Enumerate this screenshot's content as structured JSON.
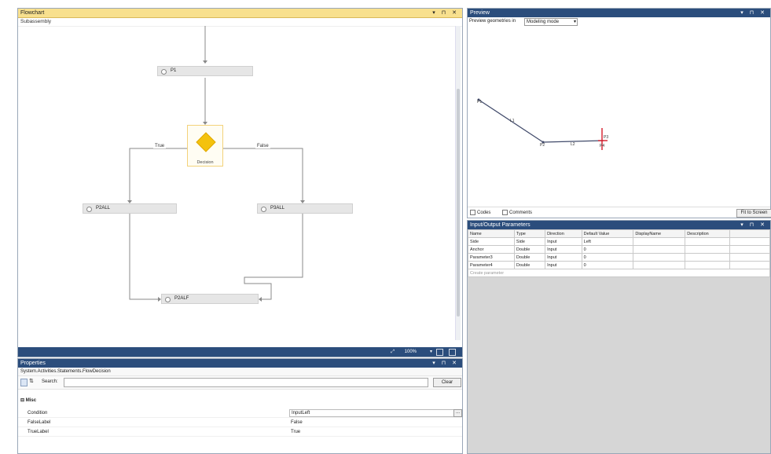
{
  "flowchart": {
    "title": "Flowchart",
    "title_buttons": "▾ ⊓ ✕",
    "breadcrumb": "Subassembly",
    "nodes": {
      "top": "P1",
      "left": "P2ALL",
      "right": "P3ALL",
      "bottom": "P2ALF",
      "decision": "Decision"
    },
    "edges": {
      "true_label": "True",
      "false_label": "False"
    },
    "status": {
      "zoom": "100%"
    }
  },
  "properties": {
    "title": "Properties",
    "title_buttons": "▾ ⊓ ✕",
    "type_path": "System.Activities.Statements.FlowDecision",
    "search_label": "Search:",
    "search_value": "",
    "clear_button": "Clear",
    "section": "Misc",
    "rows": [
      {
        "name": "Condition",
        "value": "InputLeft"
      },
      {
        "name": "FalseLabel",
        "value": "False"
      },
      {
        "name": "TrueLabel",
        "value": "True"
      }
    ],
    "ellipsis": "..."
  },
  "preview": {
    "title": "Preview",
    "title_buttons": "▾ ⊓ ✕",
    "geometry_label": "Preview geometries in",
    "geometry_select": "Modeling mode",
    "codes_label": "Codes",
    "comments_label": "Comments",
    "fit_button": "Fit to Screen",
    "points": [
      "P1",
      "P2",
      "P3",
      "P4"
    ],
    "segments": [
      "L1",
      "L2"
    ]
  },
  "ioparams": {
    "title": "Input/Output Parameters",
    "title_buttons": "▾ ⊓ ✕",
    "columns": [
      "Name",
      "Type",
      "Direction",
      "Default Value",
      "DisplayName",
      "Description"
    ],
    "rows": [
      [
        "Side",
        "Side",
        "Input",
        "Left",
        "",
        ""
      ],
      [
        "Anchor",
        "Double",
        "Input",
        "0",
        "",
        ""
      ],
      [
        "Parameter3",
        "Double",
        "Input",
        "0",
        "",
        ""
      ],
      [
        "Parameter4",
        "Double",
        "Input",
        "0",
        "",
        ""
      ]
    ],
    "create_placeholder": "Create parameter"
  }
}
